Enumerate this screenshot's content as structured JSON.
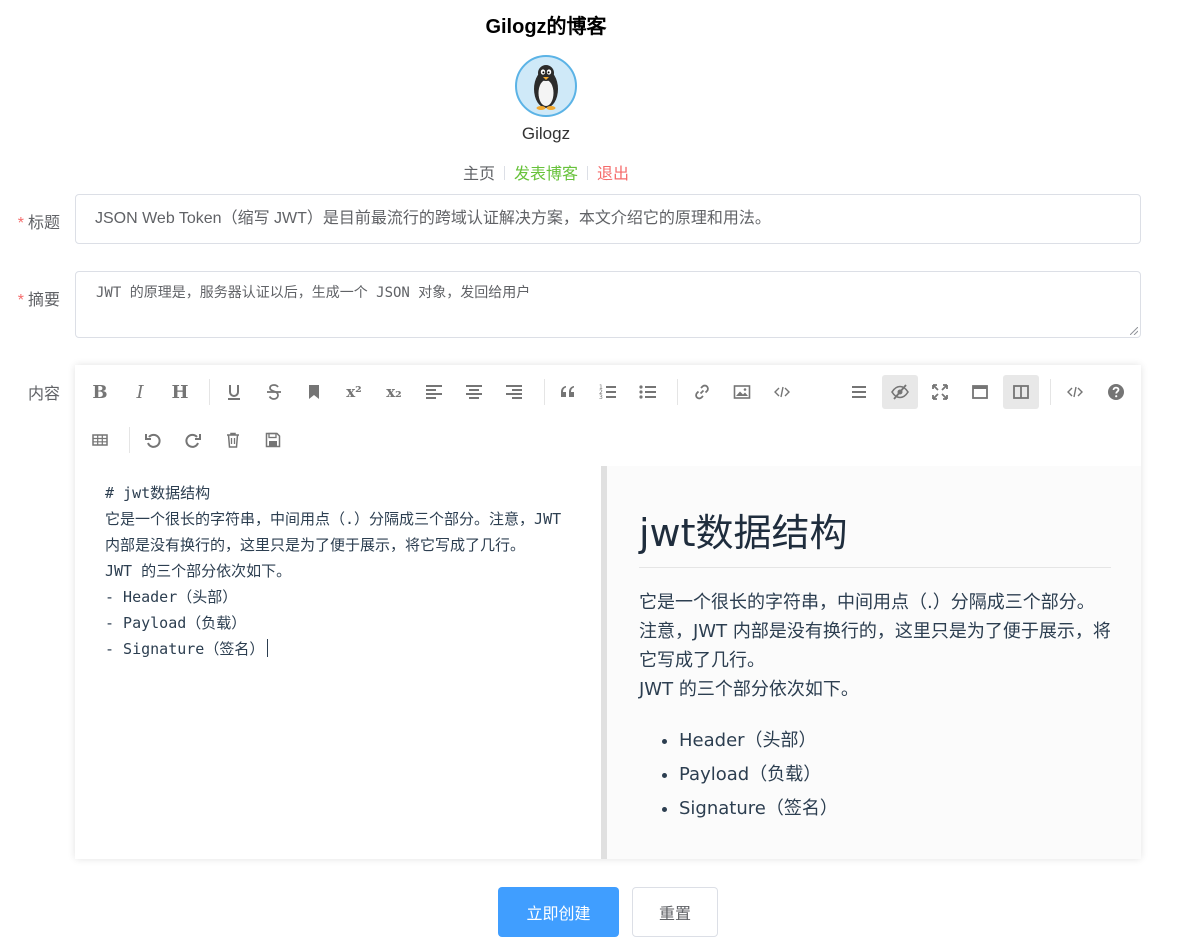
{
  "header": {
    "blog_title": "Gilogz的博客",
    "username": "Gilogz"
  },
  "nav": {
    "home": "主页",
    "post": "发表博客",
    "logout": "退出"
  },
  "form": {
    "title_label": "标题",
    "title_value": "JSON Web Token（缩写 JWT）是目前最流行的跨域认证解决方案，本文介绍它的原理和用法。",
    "summary_label": "摘要",
    "summary_value": "JWT 的原理是，服务器认证以后，生成一个 JSON 对象，发回给用户",
    "content_label": "内容",
    "required_mark": "*"
  },
  "toolbar": {
    "bold": "B",
    "italic": "I",
    "header": "H",
    "superscript": "x²",
    "subscript": "x₂"
  },
  "editor": {
    "source": "# jwt数据结构\n它是一个很长的字符串，中间用点（.）分隔成三个部分。注意，JWT 内部是没有换行的，这里只是为了便于展示，将它写成了几行。\nJWT 的三个部分依次如下。\n- Header（头部）\n- Payload（负载）\n- Signature（签名）",
    "preview": {
      "heading": "jwt数据结构",
      "paragraph_1": "它是一个很长的字符串，中间用点（.）分隔成三个部分。注意，JWT 内部是没有换行的，这里只是为了便于展示，将它写成了几行。",
      "paragraph_2": "JWT 的三个部分依次如下。",
      "list": [
        "Header（头部）",
        "Payload（负载）",
        "Signature（签名）"
      ]
    }
  },
  "actions": {
    "create": "立即创建",
    "reset": "重置"
  },
  "colors": {
    "primary": "#409eff",
    "success": "#67c23a",
    "danger": "#f56c6c"
  }
}
